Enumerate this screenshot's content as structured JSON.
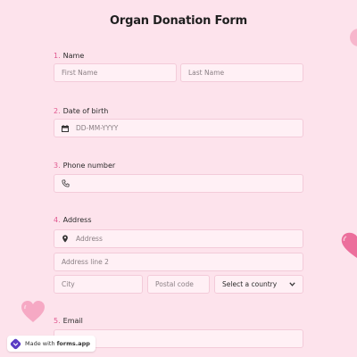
{
  "form": {
    "title": "Organ Donation Form"
  },
  "questions": {
    "name": {
      "number": "1.",
      "label": "Name",
      "first_placeholder": "First Name",
      "last_placeholder": "Last Name"
    },
    "dob": {
      "number": "2.",
      "label": "Date of birth",
      "placeholder": "DD-MM-YYYY",
      "icon": "calendar-icon"
    },
    "phone": {
      "number": "3.",
      "label": "Phone number",
      "icon": "phone-icon"
    },
    "address": {
      "number": "4.",
      "label": "Address",
      "line1_placeholder": "Address",
      "line1_icon": "location-pin-icon",
      "line2_placeholder": "Address line 2",
      "city_placeholder": "City",
      "postal_placeholder": "Postal code",
      "country_selected": "Select a country"
    },
    "email": {
      "number": "5.",
      "label": "Email"
    }
  },
  "badge": {
    "prefix": "Made with",
    "brand": "forms.app"
  },
  "colors": {
    "background": "#fde3ec",
    "accent": "#e0578f",
    "heart": "#f08bb0"
  }
}
